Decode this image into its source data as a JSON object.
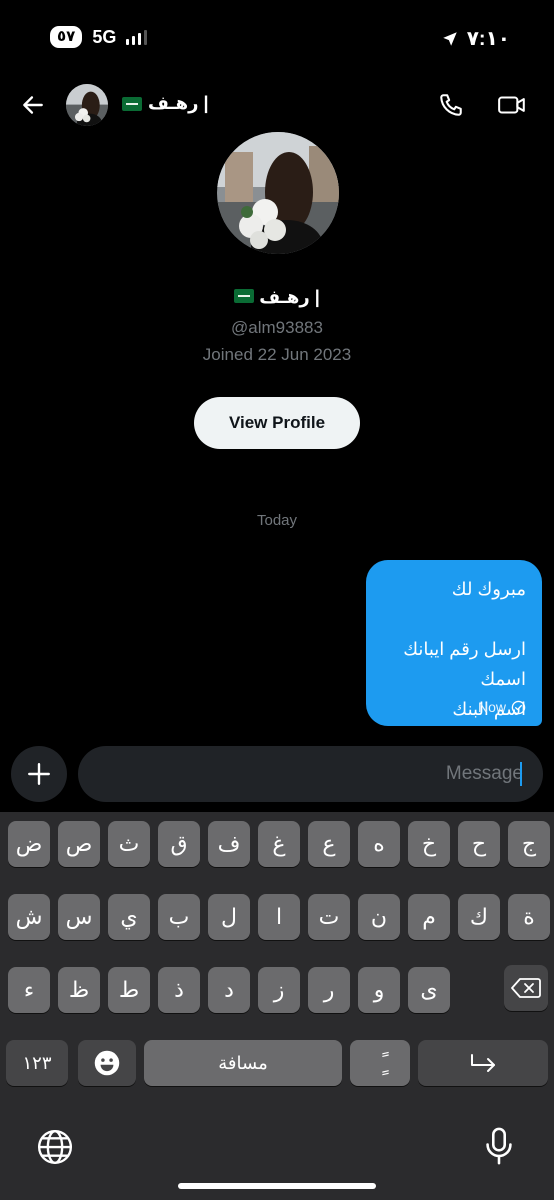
{
  "status_bar": {
    "battery": "٥٧",
    "network": "5G",
    "time": "٧:١٠"
  },
  "header": {
    "name": "رهـف |",
    "icons": [
      "back-arrow-icon",
      "phone-icon",
      "video-camera-icon"
    ]
  },
  "profile": {
    "name": "رهـف |",
    "handle": "@alm93883",
    "joined": "Joined 22 Jun 2023",
    "view_profile_label": "View Profile"
  },
  "conversation": {
    "date_separator": "Today",
    "messages": [
      {
        "lines": [
          "مبروك لك",
          "",
          "ارسل رقم ايبانك",
          "اسمك",
          "اسم البنك"
        ],
        "time": "Now",
        "status": "sent"
      }
    ]
  },
  "composer": {
    "placeholder": "Message"
  },
  "keyboard": {
    "row1": [
      "ض",
      "ص",
      "ث",
      "ق",
      "ف",
      "غ",
      "ع",
      "ه",
      "خ",
      "ح",
      "ج"
    ],
    "row2": [
      "ش",
      "س",
      "ي",
      "ب",
      "ل",
      "ا",
      "ت",
      "ن",
      "م",
      "ك",
      "ة"
    ],
    "row3": [
      "ء",
      "ظ",
      "ط",
      "ذ",
      "د",
      "ز",
      "ر",
      "و",
      "ى"
    ],
    "numbers_label": "١٢٣",
    "space_label": "مسافة",
    "diacritic_label": "ًٍ"
  },
  "colors": {
    "accent": "#1d9bf0",
    "background": "#000000",
    "muted": "#71767b",
    "key": "#6b6b6d",
    "key_fn": "#454547"
  }
}
